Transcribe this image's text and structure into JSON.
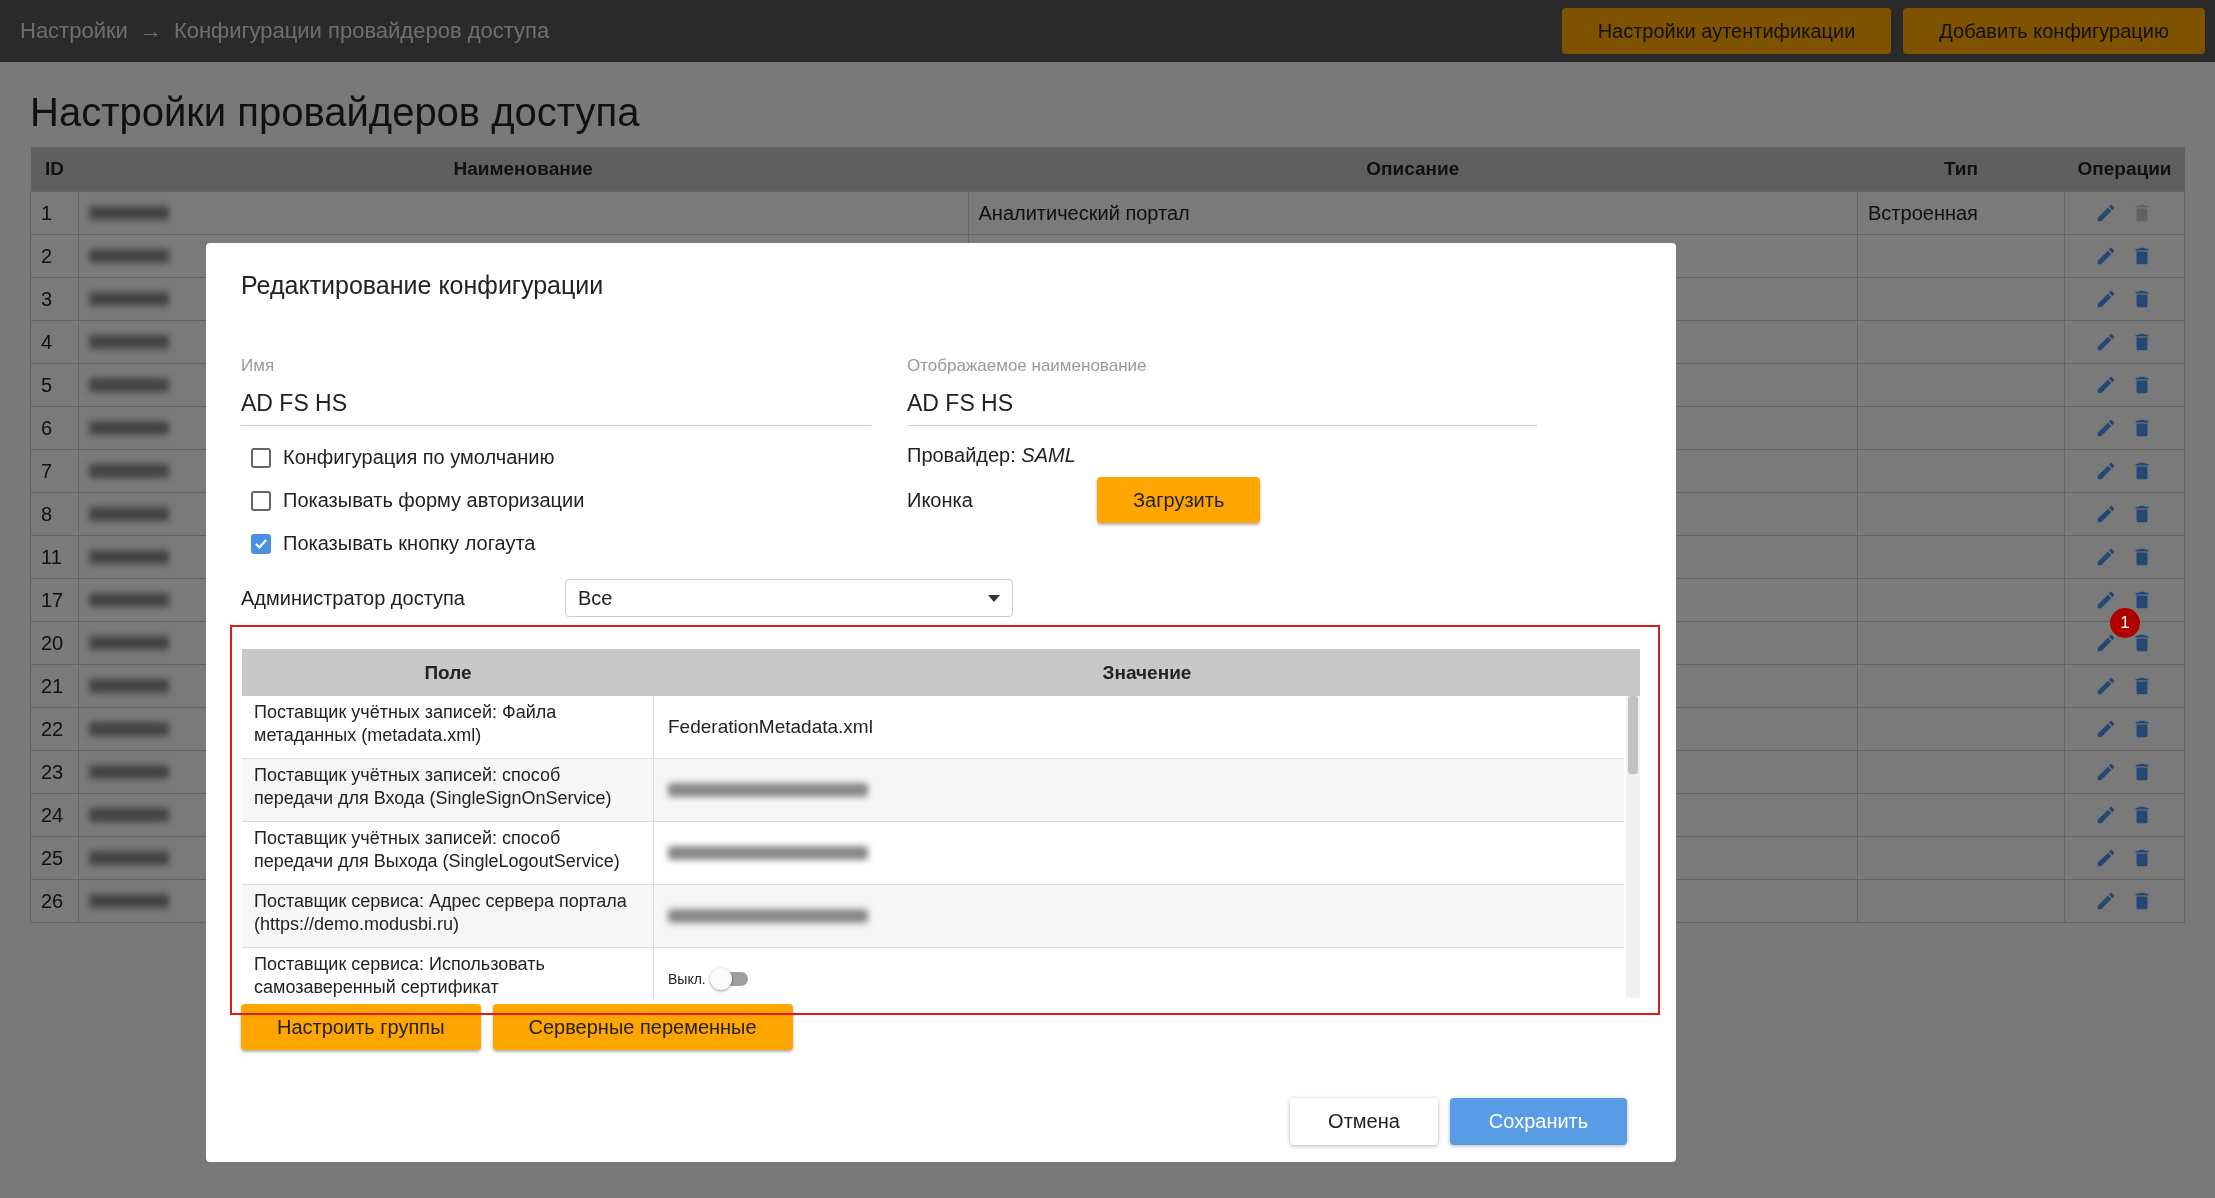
{
  "breadcrumb": {
    "items": [
      "Настройки",
      "Конфигурации провайдеров доступа"
    ],
    "separator": "→"
  },
  "top_buttons": [
    "Настройки аутентификации",
    "Добавить конфигурацию"
  ],
  "page_title": "Настройки провайдеров доступа",
  "table": {
    "columns": [
      "ID",
      "Наименование",
      "Описание",
      "Тип",
      "Операции"
    ],
    "rows": [
      {
        "number": "1",
        "name_redacted": true,
        "description": "Аналитический портал",
        "type": "Встроенная",
        "deletable": false
      },
      {
        "number": "2",
        "name_redacted": true,
        "deletable": true
      },
      {
        "number": "3",
        "name_redacted": true,
        "deletable": true
      },
      {
        "number": "4",
        "name_redacted": true,
        "deletable": true
      },
      {
        "number": "5",
        "name_redacted": true,
        "deletable": true
      },
      {
        "number": "6",
        "name_redacted": true,
        "deletable": true
      },
      {
        "number": "7",
        "name_redacted": true,
        "deletable": true
      },
      {
        "number": "8",
        "name_redacted": true,
        "deletable": true
      },
      {
        "number": "11",
        "name_redacted": true,
        "deletable": true
      },
      {
        "number": "17",
        "name_redacted": true,
        "deletable": true
      },
      {
        "number": "20",
        "name_redacted": true,
        "deletable": true
      },
      {
        "number": "21",
        "name_redacted": true,
        "deletable": true
      },
      {
        "number": "22",
        "name_redacted": true,
        "deletable": true
      },
      {
        "number": "23",
        "name_redacted": true,
        "deletable": true
      },
      {
        "number": "24",
        "name_redacted": true,
        "deletable": true
      },
      {
        "number": "25",
        "name_redacted": true,
        "deletable": true
      },
      {
        "number": "26",
        "name_redacted": true,
        "deletable": true
      }
    ]
  },
  "badge": "1",
  "dialog": {
    "title": "Редактирование конфигурации",
    "fields": [
      {
        "label": "Имя",
        "value": "AD FS HS"
      },
      {
        "label": "Отображаемое наименование",
        "value": "AD FS HS"
      }
    ],
    "checkboxes": [
      {
        "label": "Конфигурация по умолчанию",
        "checked": false
      },
      {
        "label": "Показывать форму авторизации",
        "checked": false
      },
      {
        "label": "Показывать кнопку логаута",
        "checked": true
      }
    ],
    "provider": {
      "label": "Провайдер:",
      "value": "SAML"
    },
    "icon_row": {
      "label": "Иконка",
      "button": "Загрузить"
    },
    "admin": {
      "label": "Администратор доступа",
      "value": "Все"
    },
    "params": {
      "columns": [
        "Поле",
        "Значение"
      ],
      "rows": [
        {
          "field": "Поставщик учётных записей: Файла метаданных (metadata.xml)",
          "kind": "text",
          "value": "FederationMetadata.xml"
        },
        {
          "field": "Поставщик учётных записей: способ передачи для Входа (SingleSignOnService)",
          "kind": "redacted"
        },
        {
          "field": "Поставщик учётных записей: способ передачи для Выхода (SingleLogoutService)",
          "kind": "redacted"
        },
        {
          "field": "Поставщик сервиса: Адрес сервера портала (https://demo.modusbi.ru)",
          "kind": "redacted"
        },
        {
          "field": "Поставщик сервиса: Использовать самозаверенный сертификат",
          "kind": "toggle",
          "toggle_label": "Выкл.",
          "on": false
        }
      ]
    },
    "buttons": [
      "Настроить группы",
      "Серверные переменные"
    ],
    "footer": [
      {
        "label": "Отмена",
        "kind": "secondary"
      },
      {
        "label": "Сохранить",
        "kind": "primary"
      }
    ]
  }
}
